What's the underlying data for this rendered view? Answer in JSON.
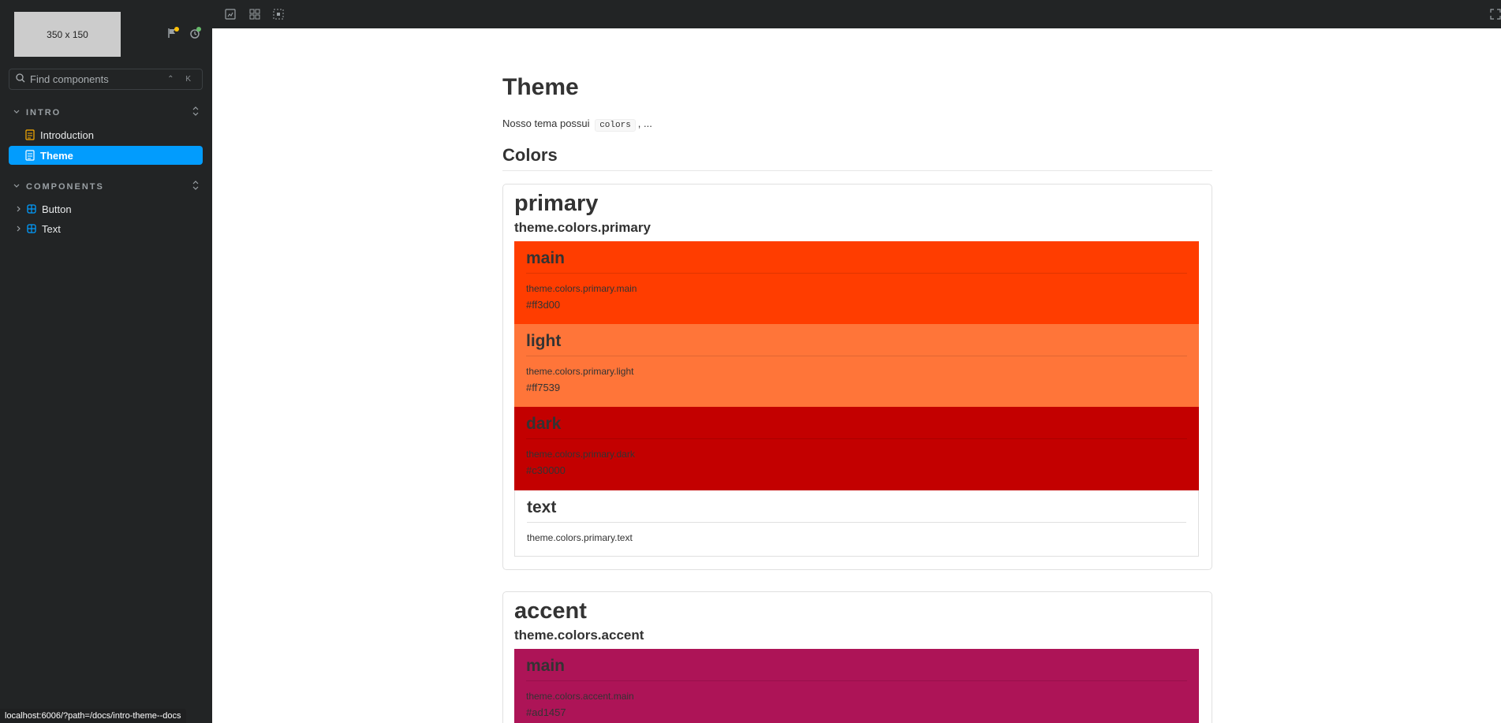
{
  "sidebar": {
    "logo_text": "350 x 150",
    "search_placeholder": "Find components",
    "search_shortcut": "⌃ K",
    "sections": [
      {
        "label": "INTRO",
        "items": [
          {
            "label": "Introduction",
            "icon": "document-icon"
          },
          {
            "label": "Theme",
            "icon": "document-icon",
            "active": true
          }
        ]
      },
      {
        "label": "COMPONENTS",
        "items": [
          {
            "label": "Button",
            "icon": "component-icon"
          },
          {
            "label": "Text",
            "icon": "component-icon"
          }
        ]
      }
    ]
  },
  "toolbar": {
    "icons": [
      "zoom-icon",
      "grid-icon",
      "outline-icon",
      "fullscreen-icon"
    ]
  },
  "doc": {
    "title": "Theme",
    "intro_before": "Nosso tema possui",
    "intro_code": "colors",
    "intro_after": ", ...",
    "section_title": "Colors",
    "groups": [
      {
        "name": "primary",
        "path": "theme.colors.primary",
        "swatches": [
          {
            "name": "main",
            "path": "theme.colors.primary.main",
            "hex": "#ff3d00",
            "color": "#ff3d00"
          },
          {
            "name": "light",
            "path": "theme.colors.primary.light",
            "hex": "#ff7539",
            "color": "#ff7539"
          },
          {
            "name": "dark",
            "path": "theme.colors.primary.dark",
            "hex": "#c30000",
            "color": "#c30000"
          },
          {
            "name": "text",
            "path": "theme.colors.primary.text",
            "hex": "",
            "color": "#ffffff"
          }
        ]
      },
      {
        "name": "accent",
        "path": "theme.colors.accent",
        "swatches": [
          {
            "name": "main",
            "path": "theme.colors.accent.main",
            "hex": "#ad1457",
            "color": "#ad1457"
          }
        ]
      }
    ]
  },
  "status_bar": {
    "url": "localhost:6006/?path=/docs/intro-theme--docs"
  },
  "colors": {
    "sidebar_bg": "#222425",
    "active_item": "#029cfd",
    "flag_dot": "#ffc107",
    "sync_dot": "#66bb6a"
  }
}
